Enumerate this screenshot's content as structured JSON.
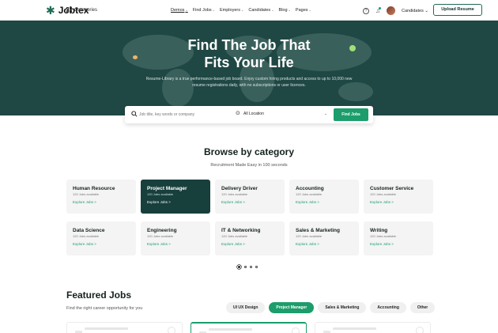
{
  "nav": {
    "logo_text": "Jobtex",
    "categories_label": "Categories",
    "menu": [
      {
        "label": "Demos",
        "active": true
      },
      {
        "label": "Find Jobs"
      },
      {
        "label": "Employers"
      },
      {
        "label": "Candidates"
      },
      {
        "label": "Blog"
      },
      {
        "label": "Pages"
      }
    ],
    "user_label": "Candidates",
    "upload_label": "Upload Resume"
  },
  "hero": {
    "title_line1": "Find The Job That",
    "title_line2": "Fits Your Life",
    "subtitle": "Resume-Library is a true performance-based job board. Enjoy custom hiring products and access to up to 10,000 new resume registrations daily, with no subscriptions or user licences."
  },
  "search": {
    "placeholder": "Job title, key words or company",
    "location": "All Location",
    "button": "Find Jobs"
  },
  "categories": {
    "title": "Browse by category",
    "subtitle": "Recruitment Made Easy in 100 seconds",
    "items": [
      {
        "name": "Human Resource",
        "count": "120 Jobs available",
        "link": "Explore Jobs  >",
        "active": false
      },
      {
        "name": "Project Manager",
        "count": "120 Jobs available",
        "link": "Explore Jobs  >",
        "active": true
      },
      {
        "name": "Delivery Driver",
        "count": "120 Jobs available",
        "link": "Explore Jobs  >",
        "active": false
      },
      {
        "name": "Accounting",
        "count": "120 Jobs available",
        "link": "Explore Jobs  >",
        "active": false
      },
      {
        "name": "Customer Service",
        "count": "120 Jobs available",
        "link": "Explore Jobs  >",
        "active": false
      },
      {
        "name": "Data Science",
        "count": "120 Jobs available",
        "link": "Explore Jobs  >",
        "active": false
      },
      {
        "name": "Engineering",
        "count": "120 Jobs available",
        "link": "Explore Jobs  >",
        "active": false
      },
      {
        "name": "IT & Networking",
        "count": "120 Jobs available",
        "link": "Explore Jobs  >",
        "active": false
      },
      {
        "name": "Sales & Marketing",
        "count": "120 Jobs available",
        "link": "Explore Jobs  >",
        "active": false
      },
      {
        "name": "Writing",
        "count": "120 Jobs available",
        "link": "Explore Jobs  >",
        "active": false
      }
    ]
  },
  "featured": {
    "title": "Featured Jobs",
    "subtitle": "Find the right career opportunity for you",
    "tabs": [
      {
        "label": "UI UX Design",
        "active": false
      },
      {
        "label": "Project Manager",
        "active": true
      },
      {
        "label": "Sales & Marketing",
        "active": false
      },
      {
        "label": "Accounting",
        "active": false
      },
      {
        "label": "Other",
        "active": false
      }
    ]
  },
  "colors": {
    "brand_dark": "#1f4744",
    "accent_green": "#1c9d6b",
    "active_card": "#173f3c"
  }
}
